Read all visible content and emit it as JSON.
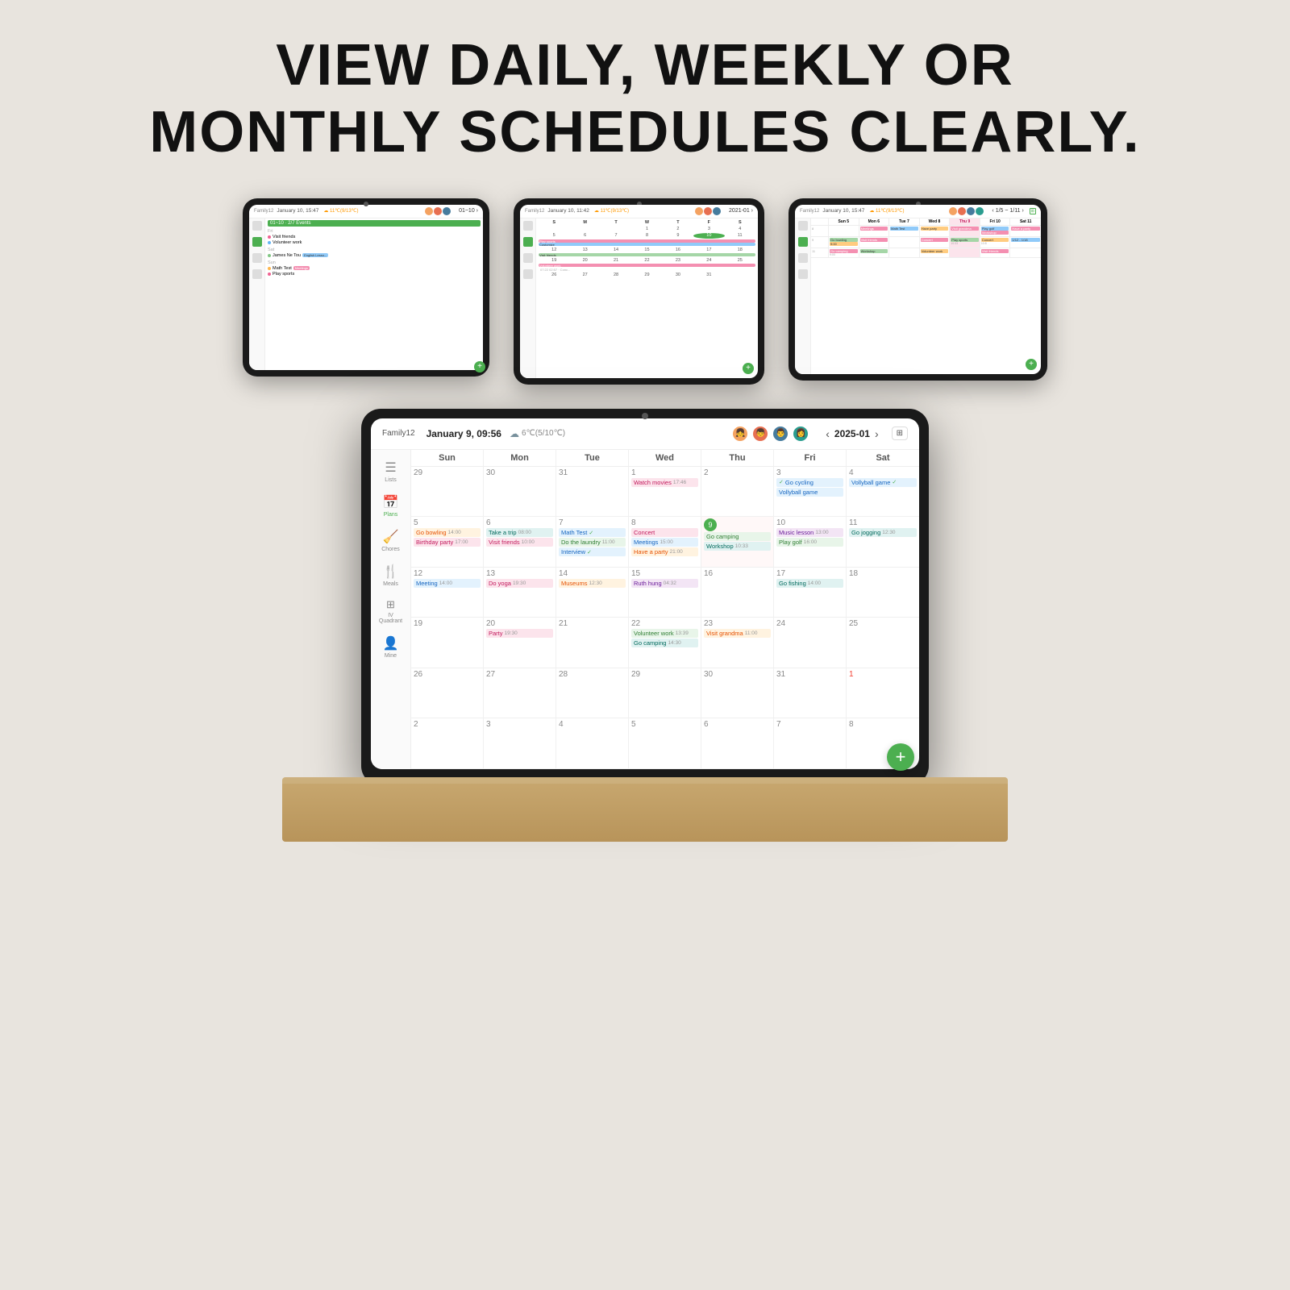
{
  "headline": {
    "line1": "VIEW DAILY, WEEKLY OR",
    "line2": "MONTHLY SCHEDULES CLEARLY."
  },
  "main_calendar": {
    "family": "Family12",
    "date": "January 9, 09:56",
    "weather_icon": "☁",
    "weather": "6℃(5/10℃)",
    "month_nav": "2025-01",
    "days": [
      "Sun",
      "Mon",
      "Tue",
      "Wed",
      "Thu",
      "Fri",
      "Sat"
    ],
    "sidebar": [
      {
        "icon": "☰",
        "label": "Lists",
        "active": false
      },
      {
        "icon": "📅",
        "label": "Plans",
        "active": true
      },
      {
        "icon": "🧹",
        "label": "Chores",
        "active": false
      },
      {
        "icon": "🍴",
        "label": "Meals",
        "active": false
      },
      {
        "icon": "⊞",
        "label": "IV Quadrant",
        "active": false
      },
      {
        "icon": "👤",
        "label": "Mine",
        "active": false
      }
    ],
    "weeks": [
      {
        "cells": [
          {
            "num": "29",
            "events": []
          },
          {
            "num": "30",
            "events": []
          },
          {
            "num": "31",
            "events": []
          },
          {
            "num": "1",
            "events": [
              {
                "text": "Watch movies",
                "time": "17:46",
                "color": "pink"
              }
            ]
          },
          {
            "num": "2",
            "events": []
          },
          {
            "num": "3",
            "events": [
              {
                "text": "Go cycling",
                "time": "",
                "color": "blue",
                "check": true
              },
              {
                "text": "Vollyball game",
                "time": "",
                "color": "blue",
                "check": true
              }
            ]
          },
          {
            "num": "4",
            "events": [
              {
                "text": "Vollyball game",
                "time": "",
                "color": "blue",
                "check": true
              }
            ]
          }
        ]
      },
      {
        "cells": [
          {
            "num": "5",
            "events": [
              {
                "text": "Go bowling",
                "time": "14:00",
                "color": "orange"
              },
              {
                "text": "Birthday party",
                "time": "17:00",
                "color": "pink"
              }
            ]
          },
          {
            "num": "6",
            "events": [
              {
                "text": "Take a trip",
                "time": "08:00",
                "color": "teal"
              },
              {
                "text": "Visit friends",
                "time": "10:00",
                "color": "pink"
              }
            ]
          },
          {
            "num": "7",
            "events": [
              {
                "text": "Math Test",
                "time": "",
                "color": "blue",
                "check": true
              },
              {
                "text": "Do the laundry",
                "time": "11:00",
                "color": "green"
              },
              {
                "text": "Interview",
                "time": "",
                "color": "blue",
                "check": true
              }
            ]
          },
          {
            "num": "8",
            "events": [
              {
                "text": "Concert",
                "time": "",
                "color": "pink"
              },
              {
                "text": "Meetings",
                "time": "15:00",
                "color": "blue"
              },
              {
                "text": "Have a party",
                "time": "21:00",
                "color": "orange"
              }
            ]
          },
          {
            "num": "9",
            "today": true,
            "events": [
              {
                "text": "Go camping",
                "time": "",
                "color": "green"
              },
              {
                "text": "Workshop",
                "time": "10:33",
                "color": "teal"
              }
            ]
          },
          {
            "num": "10",
            "events": [
              {
                "text": "Music lesson",
                "time": "13:00",
                "color": "purple"
              },
              {
                "text": "Play golf",
                "time": "16:00",
                "color": "green"
              }
            ]
          },
          {
            "num": "11",
            "events": [
              {
                "text": "Go jogging",
                "time": "12:30",
                "color": "teal"
              }
            ]
          }
        ]
      },
      {
        "cells": [
          {
            "num": "12",
            "events": [
              {
                "text": "Meeting",
                "time": "14:00",
                "color": "blue"
              }
            ]
          },
          {
            "num": "13",
            "events": [
              {
                "text": "Do yoga",
                "time": "19:30",
                "color": "pink"
              }
            ]
          },
          {
            "num": "14",
            "events": [
              {
                "text": "Museums",
                "time": "12:30",
                "color": "orange"
              }
            ]
          },
          {
            "num": "15",
            "events": [
              {
                "text": "Ruth hung",
                "time": "04:32",
                "color": "purple"
              }
            ]
          },
          {
            "num": "16",
            "events": []
          },
          {
            "num": "17",
            "events": [
              {
                "text": "Go fishing",
                "time": "14:00",
                "color": "teal"
              }
            ]
          },
          {
            "num": "18",
            "events": []
          }
        ]
      },
      {
        "cells": [
          {
            "num": "19",
            "events": []
          },
          {
            "num": "20",
            "events": [
              {
                "text": "Party",
                "time": "19:30",
                "color": "pink"
              }
            ]
          },
          {
            "num": "21",
            "events": []
          },
          {
            "num": "22",
            "events": [
              {
                "text": "Volunteer work",
                "time": "13:39",
                "color": "green"
              },
              {
                "text": "Go camping",
                "time": "14:30",
                "color": "teal"
              }
            ]
          },
          {
            "num": "23",
            "events": [
              {
                "text": "Visit grandma",
                "time": "11:00",
                "color": "orange"
              }
            ]
          },
          {
            "num": "24",
            "events": []
          },
          {
            "num": "25",
            "events": []
          }
        ]
      },
      {
        "cells": [
          {
            "num": "26",
            "events": []
          },
          {
            "num": "27",
            "events": []
          },
          {
            "num": "28",
            "events": []
          },
          {
            "num": "29",
            "events": []
          },
          {
            "num": "30",
            "events": []
          },
          {
            "num": "31",
            "events": []
          },
          {
            "num": "1",
            "events": []
          }
        ]
      },
      {
        "cells": [
          {
            "num": "2",
            "events": []
          },
          {
            "num": "3",
            "events": []
          },
          {
            "num": "4",
            "events": []
          },
          {
            "num": "5",
            "events": []
          },
          {
            "num": "6",
            "events": []
          },
          {
            "num": "7",
            "events": []
          },
          {
            "num": "8",
            "events": []
          }
        ]
      }
    ]
  }
}
